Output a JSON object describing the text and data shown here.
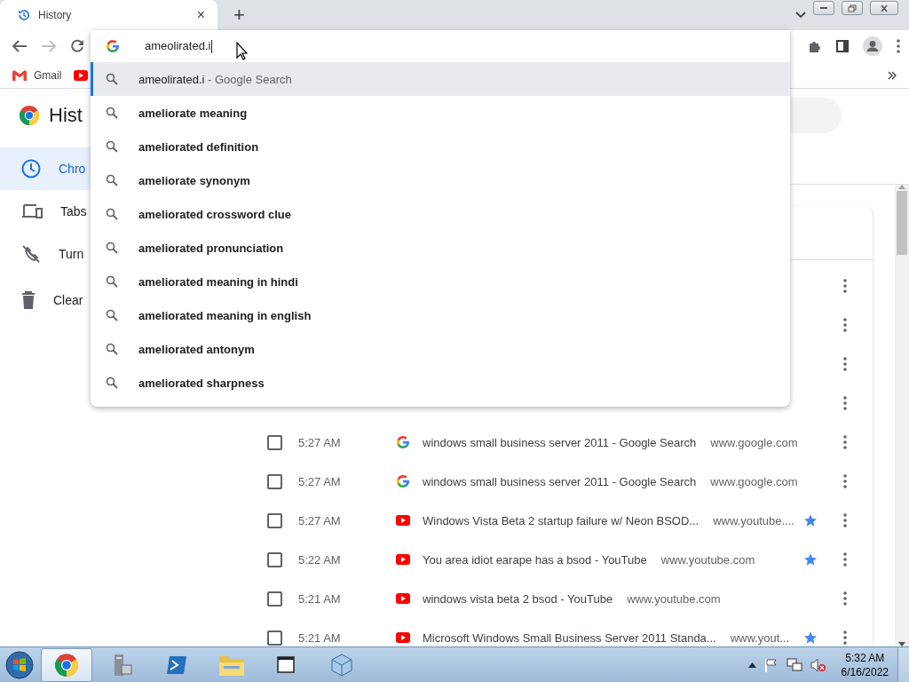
{
  "tabs": [
    {
      "title": "History",
      "close": "×",
      "selected": true
    }
  ],
  "new_tab": "+",
  "toolbar": {
    "forward_disabled": true
  },
  "bookmarks": [
    {
      "kind": "gmail",
      "label": "Gmail"
    },
    {
      "kind": "youtube"
    }
  ],
  "omnibox": {
    "value": "ameolirated.i",
    "suggestions": [
      {
        "kind": "typed",
        "text": "ameolirated.i",
        "detail": "- Google Search",
        "selected": true
      },
      {
        "kind": "suggestion",
        "text": "ameliorate meaning",
        "selected": false
      },
      {
        "kind": "suggestion",
        "text": "ameliorated definition",
        "selected": false
      },
      {
        "kind": "suggestion",
        "text": "ameliorate synonym",
        "selected": false
      },
      {
        "kind": "suggestion",
        "text": "ameliorated crossword clue",
        "selected": false
      },
      {
        "kind": "suggestion",
        "text": "ameliorated pronunciation",
        "selected": false
      },
      {
        "kind": "suggestion",
        "text": "ameliorated meaning in hindi",
        "selected": false
      },
      {
        "kind": "suggestion",
        "text": "ameliorated meaning in english",
        "selected": false
      },
      {
        "kind": "suggestion",
        "text": "ameliorated antonym",
        "selected": false
      },
      {
        "kind": "suggestion",
        "text": "ameliorated sharpness",
        "selected": false
      }
    ]
  },
  "page": {
    "title": "Hist",
    "sidebar": [
      {
        "kind": "clock",
        "label": "Chro",
        "selected": true
      },
      {
        "kind": "devices",
        "label": "Tabs",
        "selected": false
      },
      {
        "kind": "sync-off",
        "label": "Turn",
        "selected": false
      },
      {
        "kind": "trash",
        "label": "Clear",
        "selected": false
      }
    ],
    "rows": [
      {
        "kind": "covered"
      },
      {
        "kind": "covered"
      },
      {
        "kind": "covered"
      },
      {
        "kind": "covered"
      },
      {
        "kind": "google",
        "checked": false,
        "time": "5:27 AM",
        "title": "windows small business server 2011 - Google Search",
        "domain": "www.google.com",
        "starred": false
      },
      {
        "kind": "google",
        "checked": false,
        "time": "5:27 AM",
        "title": "windows small business server 2011 - Google Search",
        "domain": "www.google.com",
        "starred": false
      },
      {
        "kind": "youtube",
        "checked": false,
        "time": "5:27 AM",
        "title": "Windows Vista Beta 2 startup failure w/ Neon BSOD...",
        "domain": "www.youtube....",
        "starred": true
      },
      {
        "kind": "youtube",
        "checked": false,
        "time": "5:22 AM",
        "title": "You area idiot earape has a bsod - YouTube",
        "domain": "www.youtube.com",
        "starred": true
      },
      {
        "kind": "youtube",
        "checked": false,
        "time": "5:21 AM",
        "title": "windows vista beta 2 bsod - YouTube",
        "domain": "www.youtube.com",
        "starred": false
      },
      {
        "kind": "youtube",
        "checked": false,
        "time": "5:21 AM",
        "title": "Microsoft Windows Small Business Server 2011 Standa...",
        "domain": "www.yout...",
        "starred": true
      }
    ]
  },
  "taskbar": {
    "apps": [
      {
        "kind": "chrome",
        "active": true
      },
      {
        "kind": "server",
        "active": false
      },
      {
        "kind": "powershell",
        "active": false
      },
      {
        "kind": "folder",
        "active": false
      },
      {
        "kind": "window",
        "active": false
      },
      {
        "kind": "cube",
        "active": false
      }
    ],
    "clock": {
      "time": "5:32 AM",
      "date": "6/16/2022"
    }
  }
}
